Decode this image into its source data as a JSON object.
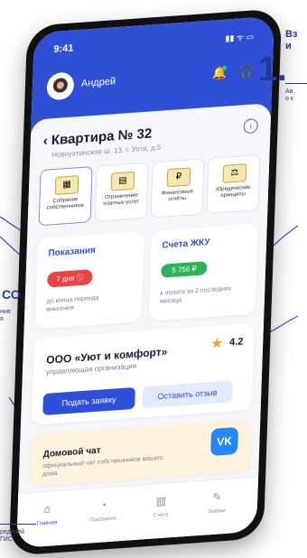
{
  "statusbar": {
    "time": "9:41",
    "icons": "▮▮ ᯤ ▭"
  },
  "header": {
    "username": "Андрей"
  },
  "apartment": {
    "title": "‹ Квартира № 32",
    "address": "Новоухтинское ш. 13, г. Ухта, д.5"
  },
  "tiles": [
    {
      "label": "Собрание собственников",
      "icon": "▦"
    },
    {
      "label": "Ограничение платных услуг",
      "icon": "▤"
    },
    {
      "label": "Финансовые отчёты",
      "icon": "₽"
    },
    {
      "label": "Юридические принципы",
      "icon": "⚖"
    }
  ],
  "readings": {
    "title": "Показания",
    "badge": "7 дня ⓘ",
    "subtitle": "до конца периода внесения"
  },
  "bills": {
    "title": "Счета ЖКУ",
    "badge": "5 756 ₽",
    "subtitle": "к оплате за 2 последних месяца"
  },
  "org": {
    "name": "ООО «Уют и комфорт»",
    "subtitle": "управляющая организация",
    "rating": "4.2",
    "submit_label": "Подать заявку",
    "review_label": "Оставить отзыв"
  },
  "chat": {
    "title": "Домовой чат",
    "subtitle": "официальный чат собственников вашего дома",
    "vk_label": "VK"
  },
  "tabs": [
    {
      "label": "Главная",
      "icon": "⌂"
    },
    {
      "label": "Показания",
      "icon": "◔"
    },
    {
      "label": "Счета",
      "icon": "▥"
    },
    {
      "label": "Заявки",
      "icon": "✎"
    }
  ],
  "annotations": {
    "number": "1.",
    "title_line1": "Вз",
    "title_line2": "и",
    "desc_line1": "Ав",
    "desc_line2": "о к",
    "left_big": "СО",
    "left_line1": "ния",
    "left_line2": "я",
    "bottom_line1": "редачей",
    "bottom_line2": "ГИС"
  },
  "colors": {
    "brand": "#2f4fd6",
    "red": "#e84444",
    "green": "#2fb05a",
    "star": "#f5a623",
    "vk": "#2787f5"
  }
}
